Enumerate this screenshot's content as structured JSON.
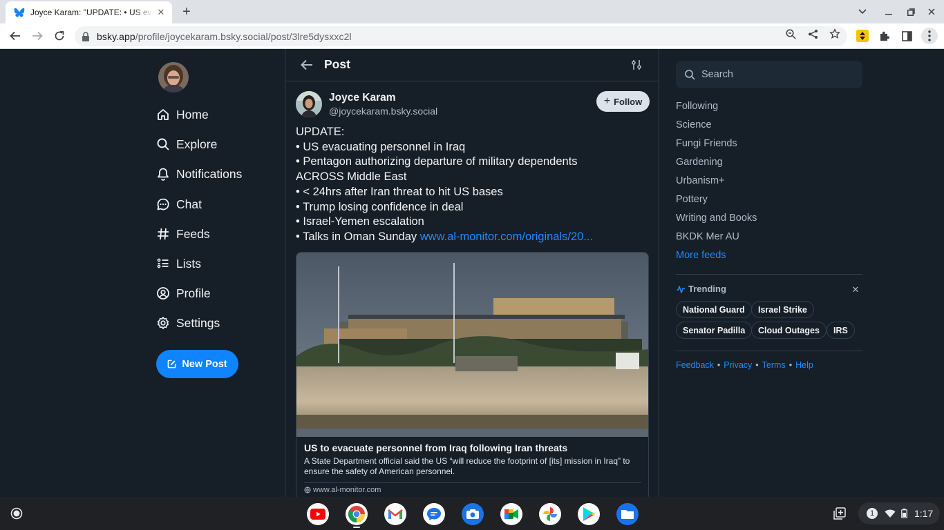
{
  "browser": {
    "tab_title": "Joyce Karam: \"UPDATE: • US evacuating personnel in Iraq",
    "url_host": "bsky.app",
    "url_path": "/profile/joycekaram.bsky.social/post/3lre5dysxxc2l"
  },
  "nav": {
    "items": [
      {
        "label": "Home",
        "icon": "home-icon"
      },
      {
        "label": "Explore",
        "icon": "search-icon"
      },
      {
        "label": "Notifications",
        "icon": "bell-icon"
      },
      {
        "label": "Chat",
        "icon": "chat-icon"
      },
      {
        "label": "Feeds",
        "icon": "hash-icon"
      },
      {
        "label": "Lists",
        "icon": "list-icon"
      },
      {
        "label": "Profile",
        "icon": "profile-icon"
      },
      {
        "label": "Settings",
        "icon": "gear-icon"
      }
    ],
    "new_post_label": "New Post"
  },
  "post_view": {
    "header_title": "Post",
    "author": {
      "name": "Joyce Karam",
      "handle": "@joycekaram.bsky.social"
    },
    "follow_label": "Follow",
    "text_lines": [
      "UPDATE:",
      "• US evacuating personnel in Iraq",
      "• Pentagon authorizing departure of military dependents",
      "ACROSS Middle East",
      "• < 24hrs after Iran threat to hit US bases",
      "• Trump losing confidence in deal",
      "• Israel-Yemen escalation",
      "• Talks in Oman Sunday "
    ],
    "link_text": "www.al-monitor.com/originals/20...",
    "embed": {
      "title": "US to evacuate personnel from Iraq following Iran threats",
      "description": "A State Department official said the US “will reduce the footprint of [its] mission in Iraq” to ensure the safety of American personnel.",
      "domain": "www.al-monitor.com"
    }
  },
  "sidebar": {
    "search_placeholder": "Search",
    "feeds": [
      "Following",
      "Science",
      "Fungi Friends",
      "Gardening",
      "Urbanism+",
      "Pottery",
      "Writing and Books",
      "BKDK Mer AU"
    ],
    "more_feeds": "More feeds",
    "trending_title": "Trending",
    "trending": [
      "National Guard",
      "Israel Strike",
      "Senator Padilla",
      "Cloud Outages",
      "IRS"
    ],
    "footer": [
      "Feedback",
      "Privacy",
      "Terms",
      "Help"
    ]
  },
  "shelf": {
    "apps": [
      "YouTube",
      "Chrome",
      "Gmail",
      "Messages",
      "Camera",
      "Google Meet",
      "Google Photos",
      "Play Store",
      "Files"
    ],
    "notification_count": "1",
    "time": "1:17"
  },
  "colors": {
    "bg": "#161e27",
    "accent": "#1083fe",
    "link": "#208bfe",
    "border": "#2e4052"
  }
}
